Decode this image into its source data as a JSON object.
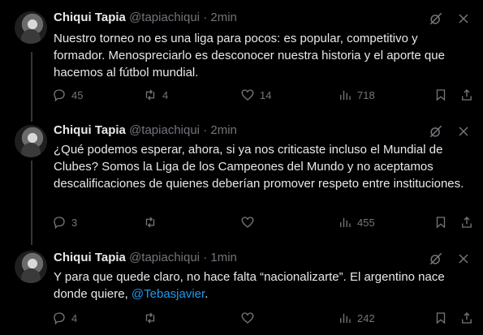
{
  "tweets": [
    {
      "name": "Chiqui Tapia",
      "handle": "@tapiachiqui",
      "dot": "·",
      "time": "2min",
      "text": "Nuestro torneo no es una liga para pocos: es popular, competitivo y formador. Menospreciarlo es desconocer nuestra historia y el aporte que hacemos al fútbol mundial.",
      "replies": "45",
      "reposts": "4",
      "likes": "14",
      "views": "718"
    },
    {
      "name": "Chiqui Tapia",
      "handle": "@tapiachiqui",
      "dot": "·",
      "time": "2min",
      "text": "¿Qué podemos esperar, ahora, si ya nos criticaste incluso el Mundial de Clubes? Somos la Liga de los Campeones del Mundo y no aceptamos descalificaciones de quienes deberían promover respeto entre instituciones.",
      "replies": "3",
      "reposts": "",
      "likes": "",
      "views": "455"
    },
    {
      "name": "Chiqui Tapia",
      "handle": "@tapiachiqui",
      "dot": "·",
      "time": "1min",
      "text_before": "Y para que quede claro, no hace falta “nacionalizarte”. El argentino nace donde quiere, ",
      "mention": "@Tebasjavier",
      "text_after": ".",
      "replies": "4",
      "reposts": "",
      "likes": "",
      "views": "242"
    }
  ],
  "icons": {
    "grok": "grok-icon",
    "more": "more-icon",
    "reply": "reply-icon",
    "repost": "repost-icon",
    "like": "like-icon",
    "views": "views-icon",
    "bookmark": "bookmark-icon",
    "share": "share-icon"
  },
  "colors": {
    "background": "#000000",
    "text": "#e7e9ea",
    "muted": "#71767b",
    "link": "#1d9bf0",
    "line": "#333639"
  }
}
